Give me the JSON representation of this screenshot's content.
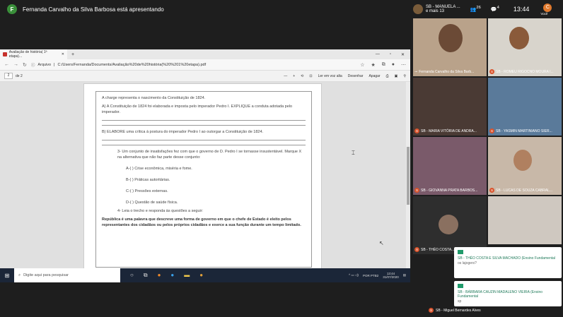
{
  "meet": {
    "presenter_initial": "F",
    "presenter_banner": "Fernanda Carvalho da Silva Barbosa está apresentando",
    "participant_preview": "SB - MANUELA ...",
    "participant_more": "e mais 13",
    "participant_count": "26",
    "chat_count": "4",
    "clock": "13:44",
    "user_initial": "C",
    "user_label": "Você"
  },
  "browser": {
    "tab_title": "Avaliação de história( 1ª etapa)...",
    "url_label": "Arquivo",
    "url": "C:/Users/Fernanda/Documents/Avaliação%20de%20história(%20%201%20etapa).pdf",
    "page_current": "2",
    "page_total": "de 2",
    "tools": [
      "Ler em voz alta",
      "Desenhar",
      "Apagar"
    ]
  },
  "pdf": {
    "intro": "A charge representa o nascimento da Constituição de 1824.",
    "qa": "A) A Constituição de 1824 foi elaborada e imposta pelo imperador Pedro I. EXPLIQUE a conduta adotada pelo imperador.",
    "qb": "B) ELABORE uma crítica à postura do imperador Pedro I ao outorgar a Constituição de 1824.",
    "q3": "3-  Um conjunto de insatisfações fez com que o governo de D. Pedro I se tornasse insustentável. Marque X na alternativa que não faz parte desse conjunto:",
    "options": [
      "A-(    ) Crise econômica, miséria e fome.",
      "B-(    ) Práticas autoritárias.",
      "C-(    ) Pressões externas.",
      "D-(    ) Questão de saúde física."
    ],
    "q4": "4-  Leia o trecho e responda às questões a seguir:",
    "excerpt": "República é uma palavra que descreve uma forma de governo em que o chefe de Estado é eleito pelos representantes dos cidadãos ou pelos próprios cidadãos e exerce a sua função durante um tempo limitado."
  },
  "taskbar": {
    "search_placeholder": "Digite aqui para pesquisar",
    "lang": "POR PTB2",
    "time": "13:44",
    "date": "31/07/2020"
  },
  "tiles": [
    {
      "name": "Fernanda Carvalho da Silva Barb..."
    },
    {
      "name": "SB - ROMEU RIGOCNO MOURA I..."
    },
    {
      "name": "SB - MARIA VITÓRIA DE ANDRA..."
    },
    {
      "name": "SB - YASMIN MARTINIANO SIER..."
    },
    {
      "name": "SB - GIOVANNA PRATA BARBOS..."
    },
    {
      "name": "SB - LUCAS DE SOUZA CABRAL..."
    },
    {
      "name": "SB - THÉO COSTA..."
    }
  ],
  "chat": [
    {
      "author": "SB - THÉO COSTA E SILVA MACHADO (Ensino Fundamental",
      "message": "os lajogers?"
    },
    {
      "author": "SB - BÁRBARA CAUZIN MADALENO VIEIRA (Ensino Fundamental",
      "message": "sp"
    }
  ],
  "bottom_label": "SB - Miguel Bernardes Alves",
  "colors": {
    "accent": "#1f9a6a",
    "badge": "#d9532c",
    "taskbar": "#1b2638"
  }
}
